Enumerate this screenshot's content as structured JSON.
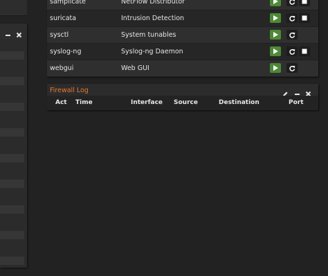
{
  "services": {
    "rows": [
      {
        "name": "samplicate",
        "description": "NetFlow Distributor",
        "has_stop": true
      },
      {
        "name": "suricata",
        "description": "Intrusion Detection",
        "has_stop": true
      },
      {
        "name": "sysctl",
        "description": "System tunables",
        "has_stop": false
      },
      {
        "name": "syslog-ng",
        "description": "Syslog-ng Daemon",
        "has_stop": true
      },
      {
        "name": "webgui",
        "description": "Web GUI",
        "has_stop": false
      }
    ]
  },
  "firewall_log": {
    "title": "Firewall Log",
    "columns": [
      "Act",
      "Time",
      "Interface",
      "Source",
      "Destination",
      "Port"
    ]
  },
  "colors": {
    "accent": "#e57a2e",
    "play_button": "#4c8a35",
    "background": "#222222"
  },
  "icons": {
    "widget_controls": [
      "pencil-icon",
      "minimize-icon",
      "close-icon"
    ],
    "service_controls": [
      "play-icon",
      "restart-icon",
      "stop-icon"
    ]
  }
}
